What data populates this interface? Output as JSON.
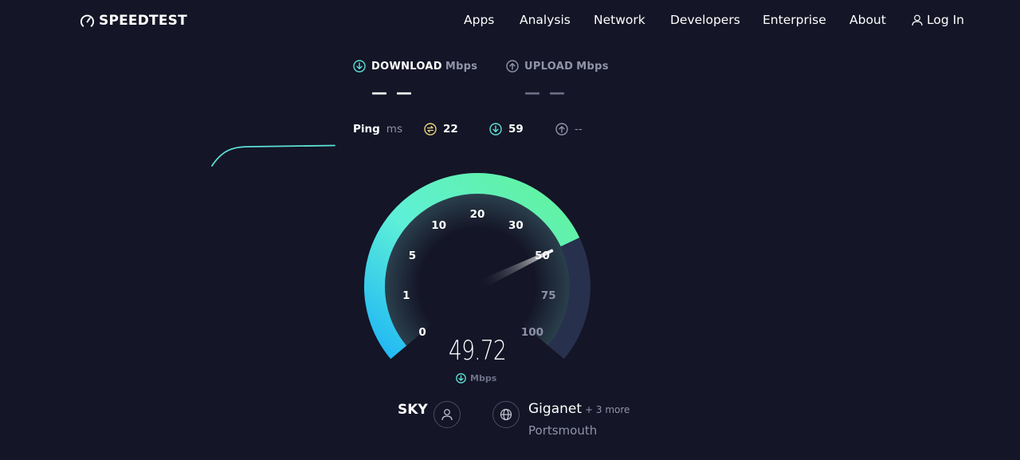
{
  "header": {
    "logo_text": "SPEEDTEST",
    "nav": [
      {
        "label": "Apps"
      },
      {
        "label": "Analysis"
      },
      {
        "label": "Network"
      },
      {
        "label": "Developers"
      },
      {
        "label": "Enterprise"
      },
      {
        "label": "About"
      }
    ],
    "login_label": "Log In",
    "login_icon": "user-icon"
  },
  "download": {
    "icon": "download-arrow-icon",
    "label": "DOWNLOAD",
    "unit": "Mbps",
    "value": "— —"
  },
  "upload": {
    "icon": "upload-arrow-icon",
    "label": "UPLOAD",
    "unit": "Mbps",
    "value": "— —"
  },
  "ping": {
    "label": "Ping",
    "unit": "ms",
    "idle": {
      "icon": "ping-idle-icon",
      "value": "22"
    },
    "download": {
      "icon": "download-arrow-icon",
      "value": "59"
    },
    "upload": {
      "icon": "upload-arrow-icon",
      "value": "--"
    }
  },
  "gauge": {
    "ticks": [
      "0",
      "1",
      "5",
      "10",
      "20",
      "30",
      "50",
      "75",
      "100"
    ],
    "current_value": 49.72,
    "current_display": "49.72",
    "unit": "Mbps",
    "colors": {
      "start": "#1fb6f5",
      "mid": "#5ef0d8",
      "end": "#62f29a",
      "track": "#27304d"
    }
  },
  "provider": {
    "isp": "SKY",
    "isp_icon": "user-icon",
    "server_icon": "globe-icon",
    "server_name": "Giganet",
    "server_more": "+ 3 more",
    "server_location": "Portsmouth"
  },
  "colors": {
    "background": "#141526",
    "accent": "#5ce1d6",
    "ping_yellow": "#e6d37a",
    "muted": "#9193a8"
  }
}
